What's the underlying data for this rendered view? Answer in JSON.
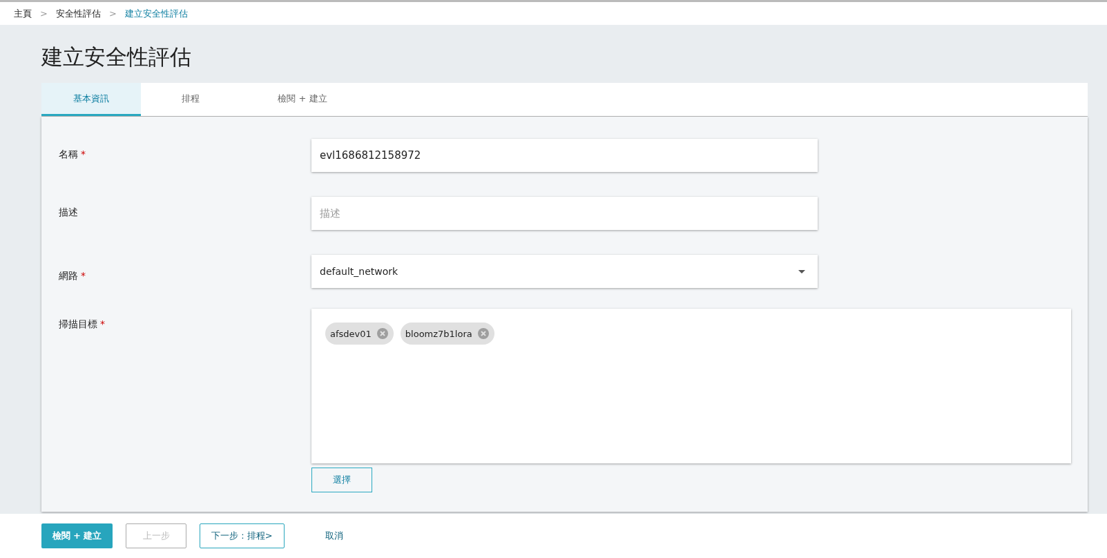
{
  "breadcrumb": [
    {
      "label": "主頁",
      "current": false
    },
    {
      "label": "安全性評估",
      "current": false
    },
    {
      "label": "建立安全性評估",
      "current": true
    }
  ],
  "breadcrumb_separator": ">",
  "title": "建立安全性評估",
  "tabs": [
    {
      "label": "基本資訊",
      "selected": true
    },
    {
      "label": "排程",
      "selected": false
    },
    {
      "label": "檢閱 + 建立",
      "selected": false
    }
  ],
  "fields": [
    {
      "kind": "text",
      "label": "名稱",
      "required": true,
      "value": "evl1686812158972"
    },
    {
      "kind": "text",
      "label": "描述",
      "required": false,
      "placeholder": "描述"
    },
    {
      "kind": "select",
      "label": "網路",
      "required": true,
      "value": "default_network"
    },
    {
      "kind": "chips",
      "label": "掃描目標",
      "required": true,
      "chips": [
        "afsdev01",
        "bloomz7b1lora"
      ],
      "button": "選擇"
    }
  ],
  "required_mark": "*",
  "footer_buttons": [
    {
      "kind": "primary",
      "label": "檢閱 + 建立",
      "disabled": false
    },
    {
      "kind": "outline",
      "label": "上一步",
      "disabled": true
    },
    {
      "kind": "outline",
      "label": "下一步 : 排程>",
      "disabled": false
    },
    {
      "kind": "link",
      "label": "取消",
      "disabled": false
    }
  ]
}
